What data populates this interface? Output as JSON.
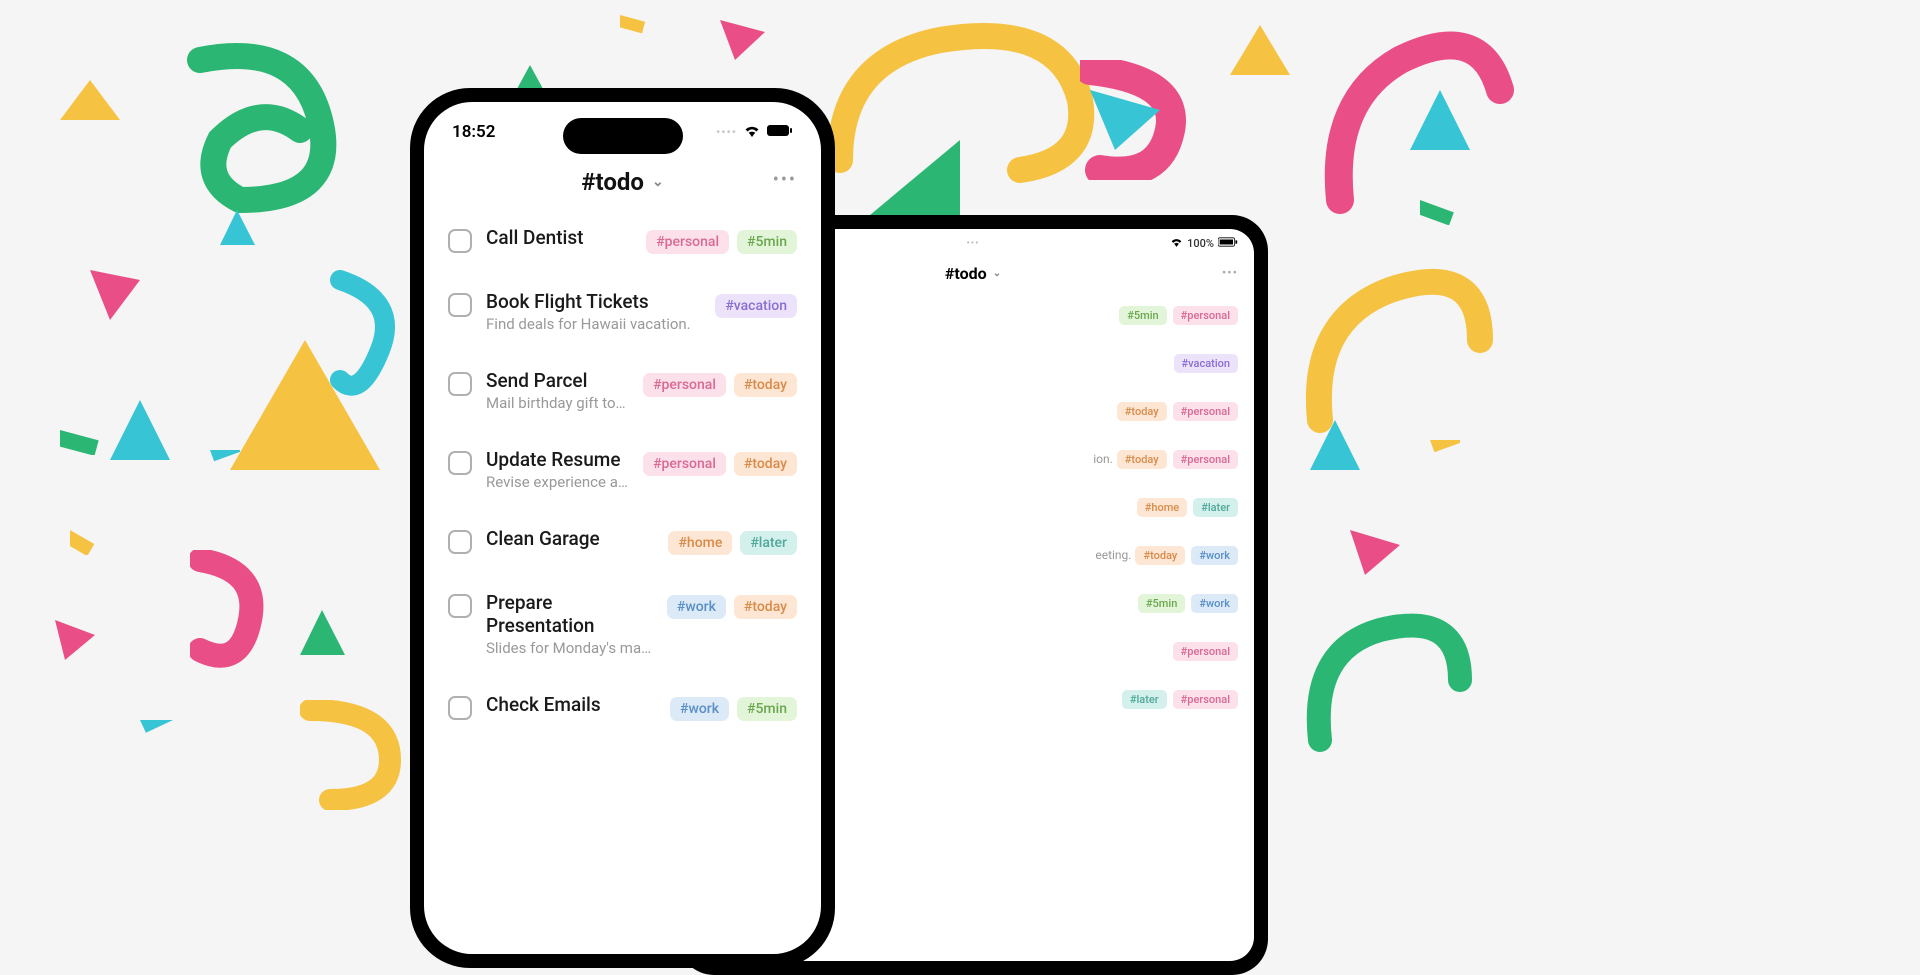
{
  "phone": {
    "statusbar": {
      "time": "18:52"
    },
    "header": {
      "title": "#todo"
    },
    "items": [
      {
        "title": "Call Dentist",
        "sub": "",
        "tags": [
          {
            "label": "#personal",
            "cls": "tag-personal"
          },
          {
            "label": "#5min",
            "cls": "tag-5min"
          }
        ]
      },
      {
        "title": "Book Flight Tickets",
        "sub": "Find deals for Hawaii vacation.",
        "tags": [
          {
            "label": "#vacation",
            "cls": "tag-vacation"
          }
        ]
      },
      {
        "title": "Send Parcel",
        "sub": "Mail birthday gift to Maria.",
        "tags": [
          {
            "label": "#personal",
            "cls": "tag-personal"
          },
          {
            "label": "#today",
            "cls": "tag-today"
          }
        ]
      },
      {
        "title": "Update Resume",
        "sub": "Revise experience and skill…",
        "tags": [
          {
            "label": "#personal",
            "cls": "tag-personal"
          },
          {
            "label": "#today",
            "cls": "tag-today"
          }
        ]
      },
      {
        "title": "Clean Garage",
        "sub": "",
        "tags": [
          {
            "label": "#home",
            "cls": "tag-home"
          },
          {
            "label": "#later",
            "cls": "tag-later"
          }
        ]
      },
      {
        "title": "Prepare Presentation",
        "sub": "Slides for Monday's marketing…",
        "tags": [
          {
            "label": "#work",
            "cls": "tag-work"
          },
          {
            "label": "#today",
            "cls": "tag-today"
          }
        ]
      },
      {
        "title": "Check Emails",
        "sub": "",
        "tags": [
          {
            "label": "#work",
            "cls": "tag-work"
          },
          {
            "label": "#5min",
            "cls": "tag-5min"
          }
        ]
      }
    ]
  },
  "tablet": {
    "statusbar": {
      "battery": "100%"
    },
    "header": {
      "title": "#todo"
    },
    "items": [
      {
        "sub_fragment": "",
        "tags": [
          {
            "label": "#5min",
            "cls": "tag-5min"
          },
          {
            "label": "#personal",
            "cls": "tag-personal"
          }
        ]
      },
      {
        "sub_fragment": "",
        "tags": [
          {
            "label": "#vacation",
            "cls": "tag-vacation"
          }
        ]
      },
      {
        "sub_fragment": "",
        "tags": [
          {
            "label": "#today",
            "cls": "tag-today"
          },
          {
            "label": "#personal",
            "cls": "tag-personal"
          }
        ]
      },
      {
        "sub_fragment": "ion.",
        "tags": [
          {
            "label": "#today",
            "cls": "tag-today"
          },
          {
            "label": "#personal",
            "cls": "tag-personal"
          }
        ]
      },
      {
        "sub_fragment": "",
        "tags": [
          {
            "label": "#home",
            "cls": "tag-home"
          },
          {
            "label": "#later",
            "cls": "tag-later"
          }
        ]
      },
      {
        "sub_fragment": "eeting.",
        "tags": [
          {
            "label": "#today",
            "cls": "tag-today"
          },
          {
            "label": "#work",
            "cls": "tag-work"
          }
        ]
      },
      {
        "sub_fragment": "",
        "tags": [
          {
            "label": "#5min",
            "cls": "tag-5min"
          },
          {
            "label": "#work",
            "cls": "tag-work"
          }
        ]
      },
      {
        "sub_fragment": "",
        "tags": [
          {
            "label": "#personal",
            "cls": "tag-personal"
          }
        ]
      },
      {
        "sub_fragment": "",
        "tags": [
          {
            "label": "#later",
            "cls": "tag-later"
          },
          {
            "label": "#personal",
            "cls": "tag-personal"
          }
        ]
      }
    ]
  }
}
